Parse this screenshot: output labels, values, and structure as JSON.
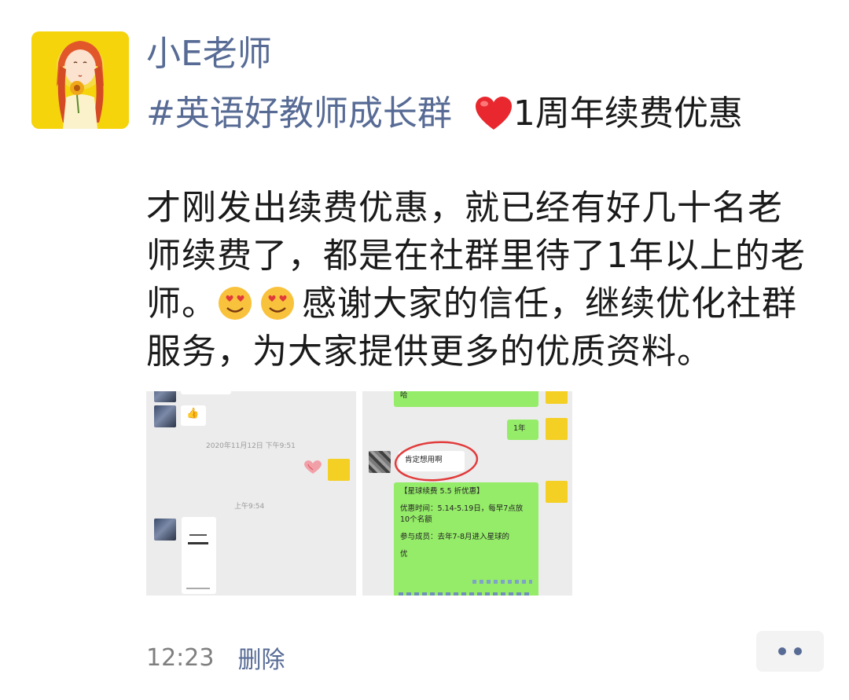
{
  "post": {
    "username": "小E老师",
    "hashtag": "#英语好教师成长群",
    "title_suffix": "1周年续费优惠",
    "body_line1": "才刚发出续费优惠，就已经有好几十名老",
    "body_line2": "师续费了，都是在社群里待了1年以上的老",
    "body_line3_a": "师。",
    "body_line3_b": "感谢大家的信任，继续优化社群",
    "body_line4": "服务，为大家提供更多的优质资料。",
    "time": "12:23",
    "delete_label": "删除"
  },
  "screenshot_left": {
    "timestamp1": "2020年11月12日 下午9:51",
    "timestamp2": "上午9:54",
    "thumb": "👍"
  },
  "screenshot_right": {
    "msg_top": "哈",
    "msg_year": "1年",
    "msg_want": "肯定想用啊",
    "promo_title": "【星球续费 5.5 折优惠】",
    "promo_time": "优惠时间：5.14-5.19日，每早7点放 10个名额",
    "promo_members": "参与成员：去年7-8月进入星球的",
    "promo_cut": "优 "
  },
  "colors": {
    "link": "#576b95",
    "chat_green": "#95ec69",
    "avatar_yellow": "#f5d40c"
  },
  "icons": {
    "heart": "heart-icon",
    "emoji": "smiling-face-with-heart-eyes-icon",
    "more": "more-dots-icon"
  }
}
